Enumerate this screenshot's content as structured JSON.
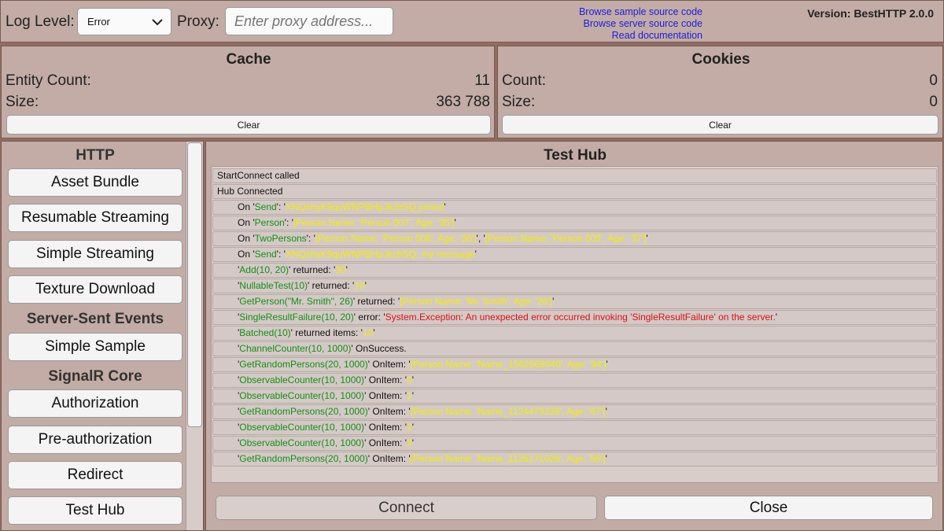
{
  "toolbar": {
    "log_level_label": "Log Level:",
    "log_level_value": "Error",
    "proxy_label": "Proxy:",
    "proxy_placeholder": "Enter proxy address...",
    "links": [
      "Browse sample source code",
      "Browse server source code",
      "Read documentation"
    ],
    "version": "Version: BestHTTP 2.0.0"
  },
  "cache": {
    "title": "Cache",
    "entity_count_label": "Entity Count:",
    "entity_count_value": "11",
    "size_label": "Size:",
    "size_value": "363 788",
    "clear_label": "Clear"
  },
  "cookies": {
    "title": "Cookies",
    "count_label": "Count:",
    "count_value": "0",
    "size_label": "Size:",
    "size_value": "0",
    "clear_label": "Clear"
  },
  "sidebar": {
    "http_title": "HTTP",
    "http_items": [
      "Asset Bundle",
      "Resumable Streaming",
      "Simple Streaming",
      "Texture Download"
    ],
    "sse_title": "Server-Sent Events",
    "sse_items": [
      "Simple Sample"
    ],
    "signalr_title": "SignalR Core",
    "signalr_items": [
      "Authorization",
      "Pre-authorization",
      "Redirect",
      "Test Hub"
    ]
  },
  "main": {
    "title": "Test Hub",
    "connect_label": "Connect",
    "close_label": "Close",
    "log": [
      {
        "indent": false,
        "parts": [
          {
            "t": "StartConnect called",
            "c": ""
          }
        ]
      },
      {
        "indent": false,
        "parts": [
          {
            "t": "Hub Connected",
            "c": ""
          }
        ]
      },
      {
        "indent": true,
        "parts": [
          {
            "t": "On '",
            "c": ""
          },
          {
            "t": "Send",
            "c": "g"
          },
          {
            "t": "': '",
            "c": ""
          },
          {
            "t": "XNQshyK9quWNPBHpJkzhSQ joined",
            "c": "y"
          },
          {
            "t": "'",
            "c": ""
          }
        ]
      },
      {
        "indent": true,
        "parts": [
          {
            "t": "On '",
            "c": ""
          },
          {
            "t": "Person",
            "c": "g"
          },
          {
            "t": "': '",
            "c": ""
          },
          {
            "t": "[Person Name: 'Person 007', Age: '35']",
            "c": "y"
          },
          {
            "t": "'",
            "c": ""
          }
        ]
      },
      {
        "indent": true,
        "parts": [
          {
            "t": "On '",
            "c": ""
          },
          {
            "t": "TwoPersons",
            "c": "g"
          },
          {
            "t": "': '",
            "c": ""
          },
          {
            "t": "[Person Name: 'Person 008', Age: '36']",
            "c": "y"
          },
          {
            "t": "', '",
            "c": ""
          },
          {
            "t": "[Person Name: 'Person 009', Age: '37']",
            "c": "y"
          },
          {
            "t": "'",
            "c": ""
          }
        ]
      },
      {
        "indent": true,
        "parts": [
          {
            "t": "On '",
            "c": ""
          },
          {
            "t": "Send",
            "c": "g"
          },
          {
            "t": "': '",
            "c": ""
          },
          {
            "t": "XNQshyK9quWNPBHpJkzhSQ: my message",
            "c": "y"
          },
          {
            "t": "'",
            "c": ""
          }
        ]
      },
      {
        "indent": true,
        "parts": [
          {
            "t": "'",
            "c": ""
          },
          {
            "t": "Add(10, 20)",
            "c": "g"
          },
          {
            "t": "' returned: '",
            "c": ""
          },
          {
            "t": "30",
            "c": "y"
          },
          {
            "t": "'",
            "c": ""
          }
        ]
      },
      {
        "indent": true,
        "parts": [
          {
            "t": "'",
            "c": ""
          },
          {
            "t": "NullableTest(10)",
            "c": "g"
          },
          {
            "t": "' returned: '",
            "c": ""
          },
          {
            "t": "10",
            "c": "y"
          },
          {
            "t": "'",
            "c": ""
          }
        ]
      },
      {
        "indent": true,
        "parts": [
          {
            "t": "'",
            "c": ""
          },
          {
            "t": "GetPerson(\"Mr. Smith\", 26)",
            "c": "g"
          },
          {
            "t": "' returned: '",
            "c": ""
          },
          {
            "t": "[Person Name: 'Mr. Smith', Age: '26']",
            "c": "y"
          },
          {
            "t": "'",
            "c": ""
          }
        ]
      },
      {
        "indent": true,
        "parts": [
          {
            "t": "'",
            "c": ""
          },
          {
            "t": "SingleResultFailure(10, 20)",
            "c": "g"
          },
          {
            "t": "' error: '",
            "c": ""
          },
          {
            "t": "System.Exception: An unexpected error occurred invoking 'SingleResultFailure' on the server.",
            "c": "r"
          },
          {
            "t": "'",
            "c": ""
          }
        ]
      },
      {
        "indent": true,
        "parts": [
          {
            "t": "'",
            "c": ""
          },
          {
            "t": "Batched(10)",
            "c": "g"
          },
          {
            "t": "' returned items: '",
            "c": ""
          },
          {
            "t": "10",
            "c": "y"
          },
          {
            "t": "'",
            "c": ""
          }
        ]
      },
      {
        "indent": true,
        "parts": [
          {
            "t": "'",
            "c": ""
          },
          {
            "t": "ChannelCounter(10, 1000)",
            "c": "g"
          },
          {
            "t": "' OnSuccess.",
            "c": ""
          }
        ]
      },
      {
        "indent": true,
        "parts": [
          {
            "t": "'",
            "c": ""
          },
          {
            "t": "GetRandomPersons(20, 1000)",
            "c": "g"
          },
          {
            "t": "' OnItem: '",
            "c": ""
          },
          {
            "t": "[Person Name: 'Name_1562669040', Age: '94']",
            "c": "y"
          },
          {
            "t": "'",
            "c": ""
          }
        ]
      },
      {
        "indent": true,
        "parts": [
          {
            "t": "'",
            "c": ""
          },
          {
            "t": "ObservableCounter(10, 1000)",
            "c": "g"
          },
          {
            "t": "' OnItem: '",
            "c": ""
          },
          {
            "t": "0",
            "c": "y"
          },
          {
            "t": "'",
            "c": ""
          }
        ]
      },
      {
        "indent": true,
        "parts": [
          {
            "t": "'",
            "c": ""
          },
          {
            "t": "ObservableCounter(10, 1000)",
            "c": "g"
          },
          {
            "t": "' OnItem: '",
            "c": ""
          },
          {
            "t": "1",
            "c": "y"
          },
          {
            "t": "'",
            "c": ""
          }
        ]
      },
      {
        "indent": true,
        "parts": [
          {
            "t": "'",
            "c": ""
          },
          {
            "t": "GetRandomPersons(20, 1000)",
            "c": "g"
          },
          {
            "t": "' OnItem: '",
            "c": ""
          },
          {
            "t": "[Person Name: 'Name_1124473236', Age: '67']",
            "c": "y"
          },
          {
            "t": "'",
            "c": ""
          }
        ]
      },
      {
        "indent": true,
        "parts": [
          {
            "t": "'",
            "c": ""
          },
          {
            "t": "ObservableCounter(10, 1000)",
            "c": "g"
          },
          {
            "t": "' OnItem: '",
            "c": ""
          },
          {
            "t": "2",
            "c": "y"
          },
          {
            "t": "'",
            "c": ""
          }
        ]
      },
      {
        "indent": true,
        "parts": [
          {
            "t": "'",
            "c": ""
          },
          {
            "t": "ObservableCounter(10, 1000)",
            "c": "g"
          },
          {
            "t": "' OnItem: '",
            "c": ""
          },
          {
            "t": "3",
            "c": "y"
          },
          {
            "t": "'",
            "c": ""
          }
        ]
      },
      {
        "indent": true,
        "parts": [
          {
            "t": "'",
            "c": ""
          },
          {
            "t": "GetRandomPersons(20, 1000)",
            "c": "g"
          },
          {
            "t": "' OnItem: '",
            "c": ""
          },
          {
            "t": "[Person Name: 'Name_1135171028', Age: '56']",
            "c": "y"
          },
          {
            "t": "'",
            "c": ""
          }
        ]
      }
    ]
  }
}
